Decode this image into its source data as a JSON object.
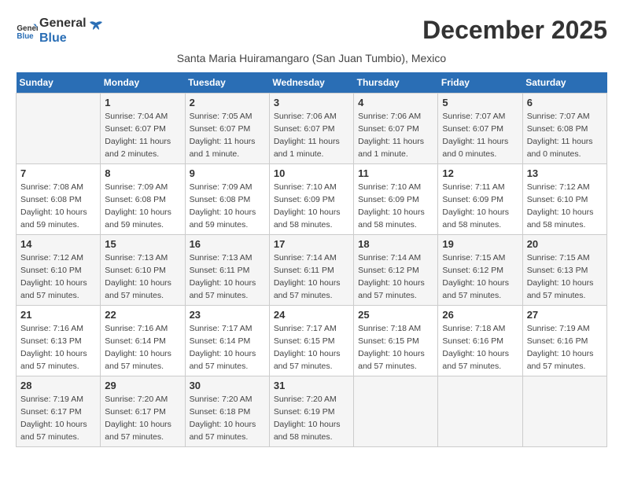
{
  "header": {
    "logo_line1": "General",
    "logo_line2": "Blue",
    "month_year": "December 2025",
    "subtitle": "Santa Maria Huiramangaro (San Juan Tumbio), Mexico"
  },
  "days_of_week": [
    "Sunday",
    "Monday",
    "Tuesday",
    "Wednesday",
    "Thursday",
    "Friday",
    "Saturday"
  ],
  "weeks": [
    [
      {
        "day": "",
        "sunrise": "",
        "sunset": "",
        "daylight": ""
      },
      {
        "day": "1",
        "sunrise": "7:04 AM",
        "sunset": "6:07 PM",
        "daylight": "11 hours and 2 minutes."
      },
      {
        "day": "2",
        "sunrise": "7:05 AM",
        "sunset": "6:07 PM",
        "daylight": "11 hours and 1 minute."
      },
      {
        "day": "3",
        "sunrise": "7:06 AM",
        "sunset": "6:07 PM",
        "daylight": "11 hours and 1 minute."
      },
      {
        "day": "4",
        "sunrise": "7:06 AM",
        "sunset": "6:07 PM",
        "daylight": "11 hours and 1 minute."
      },
      {
        "day": "5",
        "sunrise": "7:07 AM",
        "sunset": "6:07 PM",
        "daylight": "11 hours and 0 minutes."
      },
      {
        "day": "6",
        "sunrise": "7:07 AM",
        "sunset": "6:08 PM",
        "daylight": "11 hours and 0 minutes."
      }
    ],
    [
      {
        "day": "7",
        "sunrise": "7:08 AM",
        "sunset": "6:08 PM",
        "daylight": "10 hours and 59 minutes."
      },
      {
        "day": "8",
        "sunrise": "7:09 AM",
        "sunset": "6:08 PM",
        "daylight": "10 hours and 59 minutes."
      },
      {
        "day": "9",
        "sunrise": "7:09 AM",
        "sunset": "6:08 PM",
        "daylight": "10 hours and 59 minutes."
      },
      {
        "day": "10",
        "sunrise": "7:10 AM",
        "sunset": "6:09 PM",
        "daylight": "10 hours and 58 minutes."
      },
      {
        "day": "11",
        "sunrise": "7:10 AM",
        "sunset": "6:09 PM",
        "daylight": "10 hours and 58 minutes."
      },
      {
        "day": "12",
        "sunrise": "7:11 AM",
        "sunset": "6:09 PM",
        "daylight": "10 hours and 58 minutes."
      },
      {
        "day": "13",
        "sunrise": "7:12 AM",
        "sunset": "6:10 PM",
        "daylight": "10 hours and 58 minutes."
      }
    ],
    [
      {
        "day": "14",
        "sunrise": "7:12 AM",
        "sunset": "6:10 PM",
        "daylight": "10 hours and 57 minutes."
      },
      {
        "day": "15",
        "sunrise": "7:13 AM",
        "sunset": "6:10 PM",
        "daylight": "10 hours and 57 minutes."
      },
      {
        "day": "16",
        "sunrise": "7:13 AM",
        "sunset": "6:11 PM",
        "daylight": "10 hours and 57 minutes."
      },
      {
        "day": "17",
        "sunrise": "7:14 AM",
        "sunset": "6:11 PM",
        "daylight": "10 hours and 57 minutes."
      },
      {
        "day": "18",
        "sunrise": "7:14 AM",
        "sunset": "6:12 PM",
        "daylight": "10 hours and 57 minutes."
      },
      {
        "day": "19",
        "sunrise": "7:15 AM",
        "sunset": "6:12 PM",
        "daylight": "10 hours and 57 minutes."
      },
      {
        "day": "20",
        "sunrise": "7:15 AM",
        "sunset": "6:13 PM",
        "daylight": "10 hours and 57 minutes."
      }
    ],
    [
      {
        "day": "21",
        "sunrise": "7:16 AM",
        "sunset": "6:13 PM",
        "daylight": "10 hours and 57 minutes."
      },
      {
        "day": "22",
        "sunrise": "7:16 AM",
        "sunset": "6:14 PM",
        "daylight": "10 hours and 57 minutes."
      },
      {
        "day": "23",
        "sunrise": "7:17 AM",
        "sunset": "6:14 PM",
        "daylight": "10 hours and 57 minutes."
      },
      {
        "day": "24",
        "sunrise": "7:17 AM",
        "sunset": "6:15 PM",
        "daylight": "10 hours and 57 minutes."
      },
      {
        "day": "25",
        "sunrise": "7:18 AM",
        "sunset": "6:15 PM",
        "daylight": "10 hours and 57 minutes."
      },
      {
        "day": "26",
        "sunrise": "7:18 AM",
        "sunset": "6:16 PM",
        "daylight": "10 hours and 57 minutes."
      },
      {
        "day": "27",
        "sunrise": "7:19 AM",
        "sunset": "6:16 PM",
        "daylight": "10 hours and 57 minutes."
      }
    ],
    [
      {
        "day": "28",
        "sunrise": "7:19 AM",
        "sunset": "6:17 PM",
        "daylight": "10 hours and 57 minutes."
      },
      {
        "day": "29",
        "sunrise": "7:20 AM",
        "sunset": "6:17 PM",
        "daylight": "10 hours and 57 minutes."
      },
      {
        "day": "30",
        "sunrise": "7:20 AM",
        "sunset": "6:18 PM",
        "daylight": "10 hours and 57 minutes."
      },
      {
        "day": "31",
        "sunrise": "7:20 AM",
        "sunset": "6:19 PM",
        "daylight": "10 hours and 58 minutes."
      },
      {
        "day": "",
        "sunrise": "",
        "sunset": "",
        "daylight": ""
      },
      {
        "day": "",
        "sunrise": "",
        "sunset": "",
        "daylight": ""
      },
      {
        "day": "",
        "sunrise": "",
        "sunset": "",
        "daylight": ""
      }
    ]
  ]
}
